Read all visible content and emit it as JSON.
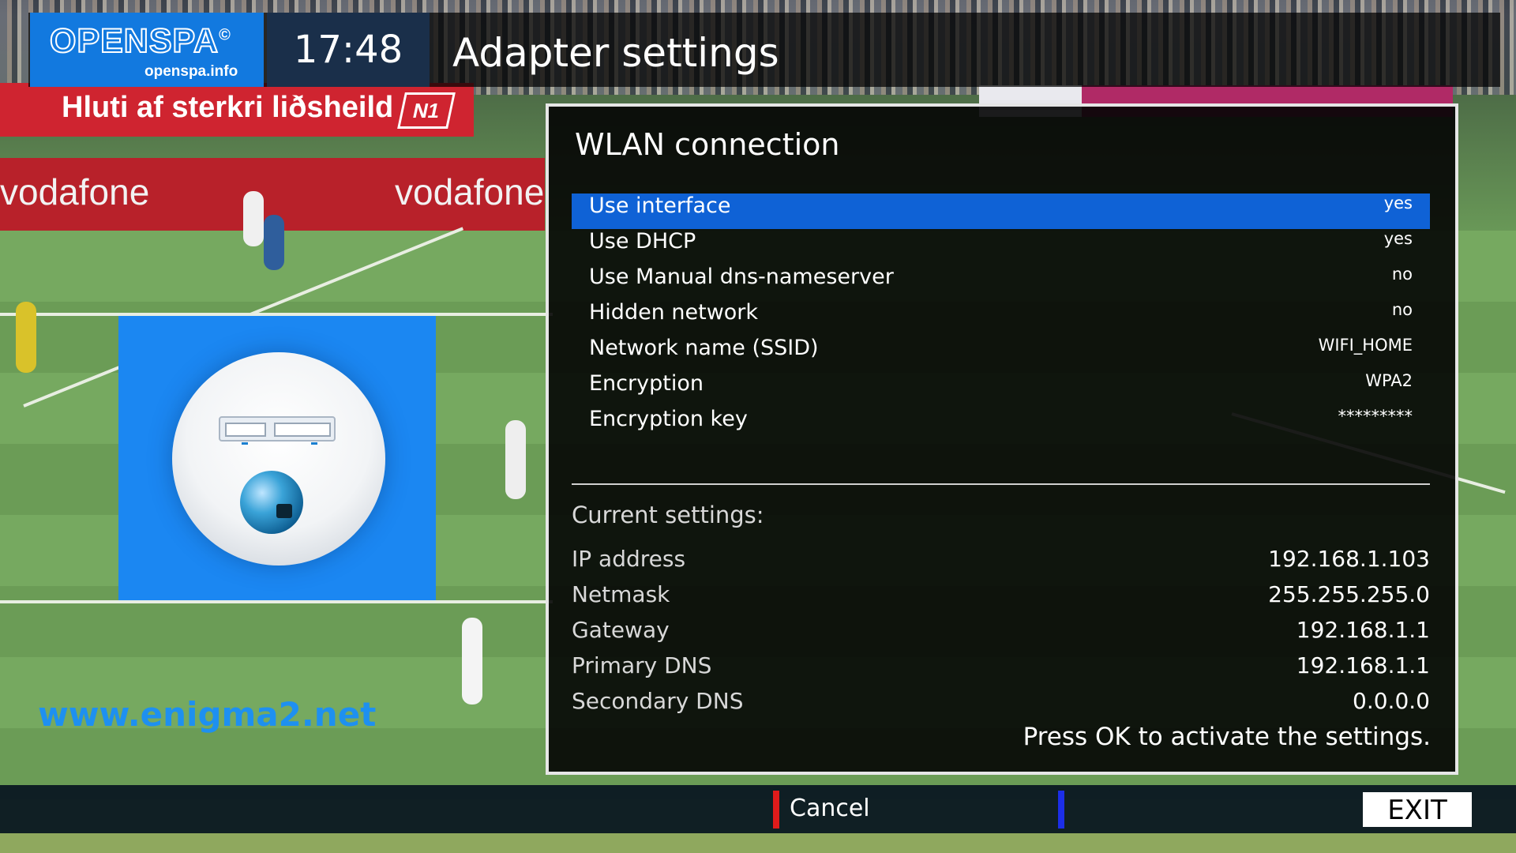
{
  "header": {
    "brand": "OPENSPA",
    "brand_mark": "©",
    "brand_url": "openspa.info",
    "clock": "17:48",
    "screen_title": "Adapter settings"
  },
  "background": {
    "banner_text": "Hluti af sterkri liðsheild",
    "banner_badge": "N1",
    "sponsor_left": "vodafone",
    "sponsor_mid": "vodafone"
  },
  "icon": {
    "name": "network-adapter-icon"
  },
  "watermark": "www.enigma2.net",
  "panel": {
    "title": "WLAN connection",
    "config": [
      {
        "label": "Use interface",
        "value": "yes",
        "selected": true
      },
      {
        "label": "Use DHCP",
        "value": "yes",
        "selected": false
      },
      {
        "label": "Use Manual dns-nameserver",
        "value": "no",
        "selected": false
      },
      {
        "label": "Hidden network",
        "value": "no",
        "selected": false
      },
      {
        "label": "Network name (SSID)",
        "value": "WIFI_HOME",
        "selected": false
      },
      {
        "label": "Encryption",
        "value": "WPA2",
        "selected": false
      },
      {
        "label": "Encryption key",
        "value": "*********",
        "selected": false
      }
    ],
    "current_settings_title": "Current settings:",
    "current": [
      {
        "label": "IP address",
        "value": "192.168.1.103"
      },
      {
        "label": "Netmask",
        "value": "255.255.255.0"
      },
      {
        "label": "Gateway",
        "value": "192.168.1.1"
      },
      {
        "label": "Primary DNS",
        "value": "192.168.1.1"
      },
      {
        "label": "Secondary DNS",
        "value": "0.0.0.0"
      }
    ],
    "hint": "Press OK to activate the settings."
  },
  "footer": {
    "red_label": "Cancel",
    "exit_label": "EXIT"
  },
  "colors": {
    "accent": "#1279df",
    "selected_row": "#0f62d6",
    "red_key": "#e01b1b",
    "blue_key": "#1c2ee8"
  }
}
